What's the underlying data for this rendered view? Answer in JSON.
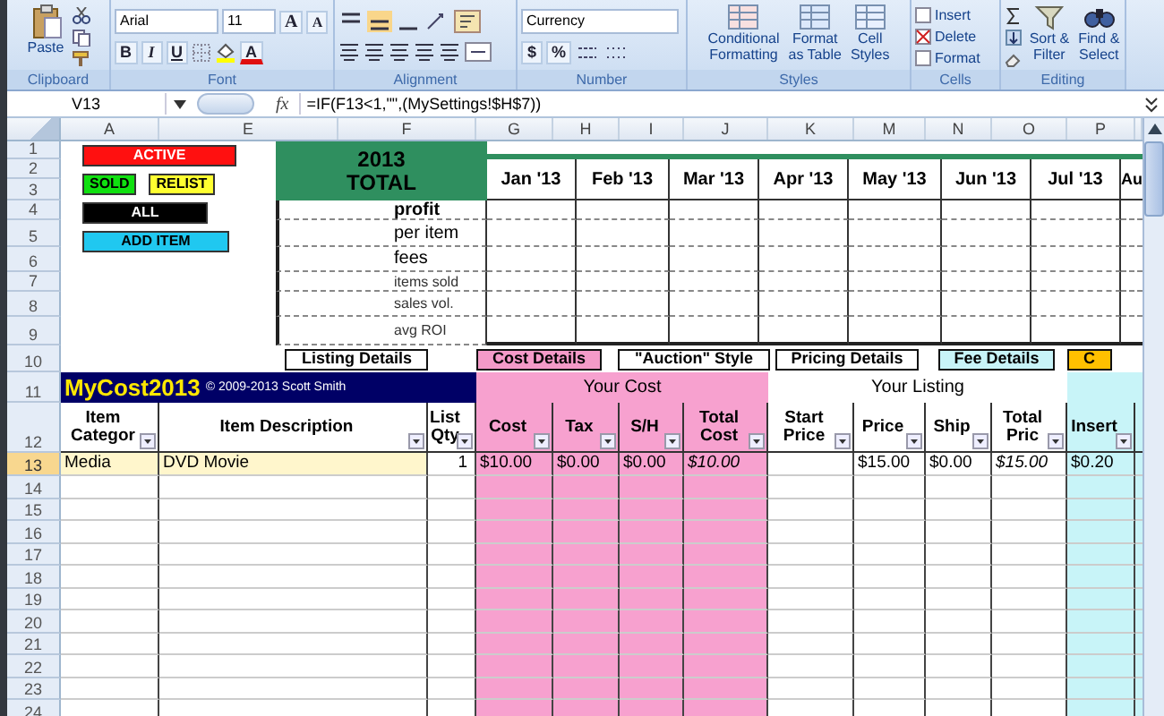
{
  "ribbon": {
    "clipboard": {
      "label": "Clipboard",
      "paste": "Paste"
    },
    "font": {
      "label": "Font",
      "font_name": "Arial",
      "font_size": "11",
      "grow_shrink": [
        "A",
        "A"
      ],
      "styles": [
        "B",
        "I",
        "U"
      ],
      "font_color": "A"
    },
    "alignment": {
      "label": "Alignment"
    },
    "number": {
      "label": "Number",
      "format": "Currency",
      "symbols": [
        "$",
        "%"
      ]
    },
    "styles": {
      "label": "Styles",
      "buttons": [
        {
          "lines": [
            "Conditional",
            "Formatting"
          ]
        },
        {
          "lines": [
            "Format",
            "as Table"
          ]
        },
        {
          "lines": [
            "Cell",
            "Styles"
          ]
        }
      ]
    },
    "cells": {
      "label": "Cells",
      "buttons": [
        "Insert",
        "Delete",
        "Format"
      ]
    },
    "editing": {
      "label": "Editing",
      "buttons": [
        {
          "lines": [
            "Sort &",
            "Filter"
          ]
        },
        {
          "lines": [
            "Find &",
            "Select"
          ]
        }
      ]
    }
  },
  "formula_bar": {
    "name_box": "V13",
    "function_symbol": "fx",
    "formula": "=IF(F13<1,\"\",(MySettings!$H$7))"
  },
  "column_letters": [
    "A",
    "E",
    "F",
    "G",
    "H",
    "I",
    "J",
    "K",
    "M",
    "N",
    "O",
    "P"
  ],
  "row_numbers": [
    {
      "label": "1",
      "selected": false
    },
    {
      "label": "2",
      "selected": false
    },
    {
      "label": "3",
      "selected": false
    },
    {
      "label": "4",
      "selected": false
    },
    {
      "label": "5",
      "selected": false
    },
    {
      "label": "6",
      "selected": false
    },
    {
      "label": "7",
      "selected": false
    },
    {
      "label": "8",
      "selected": false
    },
    {
      "label": "9",
      "selected": false
    },
    {
      "label": "10",
      "selected": false
    },
    {
      "label": "11",
      "selected": false
    },
    {
      "label": "12",
      "selected": false
    },
    {
      "label": "13",
      "selected": true
    },
    {
      "label": "14",
      "selected": false
    },
    {
      "label": "15",
      "selected": false
    },
    {
      "label": "16",
      "selected": false
    },
    {
      "label": "17",
      "selected": false
    },
    {
      "label": "18",
      "selected": false
    },
    {
      "label": "19",
      "selected": false
    },
    {
      "label": "20",
      "selected": false
    },
    {
      "label": "21",
      "selected": false
    },
    {
      "label": "22",
      "selected": false
    },
    {
      "label": "23",
      "selected": false
    },
    {
      "label": "24",
      "selected": false
    }
  ],
  "filter_buttons": [
    {
      "buttons": [
        {
          "label": "ACTIVE",
          "color": "#ff1010"
        }
      ]
    },
    {
      "buttons": [
        {
          "label": "SOLD",
          "color": "#10e010"
        },
        {
          "label": "RELIST",
          "color": "#ffff30"
        }
      ]
    },
    {
      "buttons": [
        {
          "label": "ALL",
          "color": "#000000"
        }
      ]
    },
    {
      "buttons": [
        {
          "label": "ADD ITEM",
          "color": "#20c8f0"
        }
      ]
    }
  ],
  "summary": {
    "title": [
      "2013",
      "TOTAL"
    ],
    "months": [
      "Jan '13",
      "Feb '13",
      "Mar '13",
      "Apr '13",
      "May '13",
      "Jun '13",
      "Jul '13",
      "Au"
    ],
    "rows": [
      "profit",
      "per item",
      "fees",
      "items sold",
      "sales vol.",
      "avg ROI"
    ]
  },
  "view_buttons": [
    {
      "label": "Listing Details",
      "color": "#ffffff"
    },
    {
      "label": "Cost Details",
      "color": "#f49ac8"
    },
    {
      "label": "\"Auction\" Style",
      "color": "#ffffff"
    },
    {
      "label": "Pricing Details",
      "color": "#ffffff"
    },
    {
      "label": "Fee Details",
      "color": "#c8f4f8"
    },
    {
      "label": "C",
      "color": "#ffc000"
    }
  ],
  "table": {
    "title": "MyCost2013",
    "copyright": "© 2009-2013 Scott Smith",
    "sections": [
      {
        "label": "Your Cost",
        "color": "#f7a1cf"
      },
      {
        "label": "Your Listing",
        "color": "#ffffff"
      }
    ],
    "columns": [
      {
        "label": "Item Categor",
        "kind": "text",
        "color": "#ffffff"
      },
      {
        "label": "Item Description",
        "kind": "text",
        "color": "#ffffff"
      },
      {
        "label": "List Qty",
        "kind": "qty",
        "color": "#ffffff"
      },
      {
        "label": "Cost",
        "kind": "money",
        "color": "#f7a1cf"
      },
      {
        "label": "Tax",
        "kind": "money",
        "color": "#f7a1cf"
      },
      {
        "label": "S/H",
        "kind": "money",
        "color": "#f7a1cf"
      },
      {
        "label": "Total Cost",
        "kind": "total",
        "color": "#f7a1cf"
      },
      {
        "label": "Start Price",
        "kind": "money",
        "color": "#ffffff"
      },
      {
        "label": "Price",
        "kind": "money",
        "color": "#ffffff"
      },
      {
        "label": "Ship",
        "kind": "money",
        "color": "#ffffff"
      },
      {
        "label": "Total Pric",
        "kind": "total",
        "color": "#ffffff"
      },
      {
        "label": "Insert",
        "kind": "money",
        "color": "#c8f4f8"
      }
    ],
    "rows": [
      {
        "highlighted": true,
        "cells": [
          "Media",
          "DVD Movie",
          "1",
          "$10.00",
          "$0.00",
          "$0.00",
          "$10.00",
          null,
          "$15.00",
          "$0.00",
          "$15.00",
          "$0.20"
        ]
      }
    ]
  }
}
